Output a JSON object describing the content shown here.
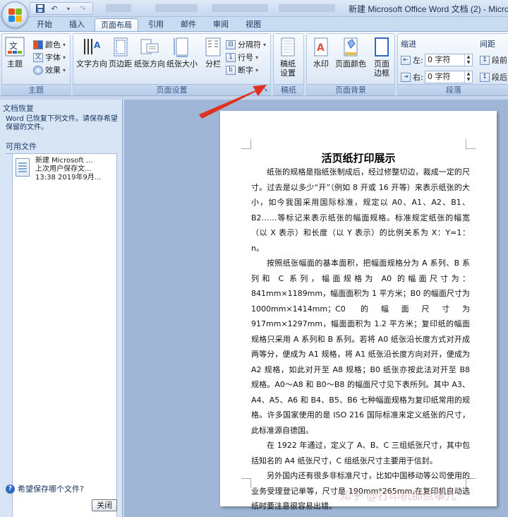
{
  "window": {
    "title": "新建 Microsoft Office Word 文档 (2) - Micros"
  },
  "tabs": [
    {
      "label": "开始"
    },
    {
      "label": "插入"
    },
    {
      "label": "页面布局"
    },
    {
      "label": "引用"
    },
    {
      "label": "邮件"
    },
    {
      "label": "审阅"
    },
    {
      "label": "视图"
    }
  ],
  "ribbon": {
    "theme_group": {
      "label": "主题",
      "theme_button": "主题",
      "colors": "颜色",
      "fonts": "字体",
      "effects": "效果"
    },
    "page_setup_group": {
      "label": "页面设置",
      "text_direction": "文字方向",
      "margins": "页边距",
      "orientation": "纸张方向",
      "size": "纸张大小",
      "columns": "分栏",
      "breaks": "分隔符",
      "line_numbers": "行号",
      "hyphenation": "断字"
    },
    "draft_group": {
      "label": "稿纸",
      "draft_settings_line1": "稿纸",
      "draft_settings_line2": "设置"
    },
    "background_group": {
      "label": "页面背景",
      "watermark": "水印",
      "page_color": "页面颜色",
      "page_borders_line1": "页面",
      "page_borders_line2": "边框"
    },
    "paragraph_group": {
      "label": "段落",
      "indent_title": "缩进",
      "spacing_title": "间距",
      "left_label": "左:",
      "right_label": "右:",
      "left_value": "0 字符",
      "right_value": "0 字符",
      "before_label": "段前",
      "after_label": "段后"
    }
  },
  "recovery_pane": {
    "title": "文档恢复",
    "message": "Word 已恢复下列文件。请保存希望保留的文件。",
    "available_files": "可用文件",
    "file": {
      "name": "新建 Microsoft ...",
      "status": "上次用户保存文...",
      "time": "13:38 2019年9月..."
    },
    "help_link": "希望保存哪个文件?",
    "close_button": "关闭"
  },
  "document": {
    "title": "活页纸打印展示",
    "paragraphs": [
      "纸张的规格是指纸张制成后，经过修整切边，裁成一定的尺寸。过去是以多少“开”（例如 8 开或 16 开等）来表示纸张的大小，如今我国采用国际标准，规定以 A0、A1、A2、B1、B2……等标记来表示纸张的幅面规格。标准规定纸张的幅宽（以 X 表示）和长度（以 Y 表示）的比例关系为 X：Y=1：n。",
      "按照纸张幅面的基本面积，把幅面规格分为 A 系列、B 系列和 C 系列，幅面规格为 A0 的幅面尺寸为：841mm×1189mm，幅面面积为 1 平方米；B0 的幅面尺寸为 1000mm×1414mm；C0 的幅面尺寸为 917mm×1297mm，幅面面积为 1.2 平方米；复印纸的幅面规格只采用 A 系列和 B 系列。若将 A0 纸张沿长度方式对开成两等分，便成为 A1 规格，将 A1 纸张沿长度方向对开，便成为 A2 规格，如此对开至 A8 规格；B0 纸张亦按此法对开至 B8 规格。A0～A8 和 B0～B8 的幅面尺寸见下表所列。其中 A3、A4、A5、A6 和 B4、B5、B6 七种幅面规格为复印纸常用的规格。许多国家使用的是 ISO 216 国际标准来定义纸张的尺寸，此标准源自德国。",
      "在 1922 年通过，定义了 A、B、C 三组纸张尺寸，其中包括知名的 A4 纸张尺寸，C 组纸张尺寸主要用于信封。",
      "另外国内还有很多非标准尺寸，比如中国移动等公司使用的业务受理登记单等，尺寸是 190mm*265mm,在复印机自动选纸时要注意很容易出错。"
    ]
  },
  "watermark_text": "知乎 @打印机那点事儿",
  "colors": {
    "arrow": "#e03020",
    "ribbon_accent": "#15325e"
  }
}
